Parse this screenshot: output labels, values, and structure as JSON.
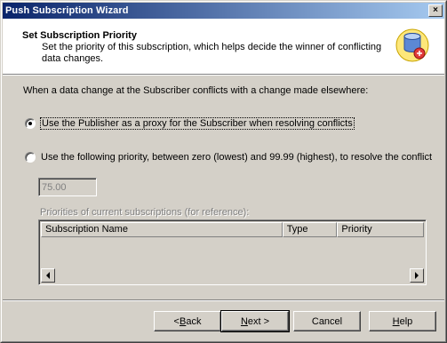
{
  "window": {
    "title": "Push Subscription Wizard",
    "close_label": "×"
  },
  "header": {
    "title": "Set Subscription Priority",
    "subtitle": "Set the priority of this subscription, which helps decide the winner of conflicting data changes.",
    "icon": "database-priority-icon"
  },
  "content": {
    "intro": "When a data change at the Subscriber conflicts with a change made elsewhere:",
    "option_proxy": {
      "label": "Use the Publisher as a proxy for the Subscriber when resolving conflicts",
      "selected": true
    },
    "option_priority": {
      "label": "Use the following priority, between zero (lowest) and 99.99 (highest), to resolve the conflict",
      "selected": false
    },
    "priority_value": "75.00",
    "priorities_label": "Priorities of current subscriptions (for reference):",
    "table": {
      "columns": [
        "Subscription Name",
        "Type",
        "Priority"
      ],
      "rows": []
    }
  },
  "buttons": {
    "back": {
      "pre": "< ",
      "key": "B",
      "post": "ack"
    },
    "next": {
      "key": "N",
      "post": "ext >"
    },
    "cancel": "Cancel",
    "help": {
      "key": "H",
      "post": "elp"
    }
  }
}
